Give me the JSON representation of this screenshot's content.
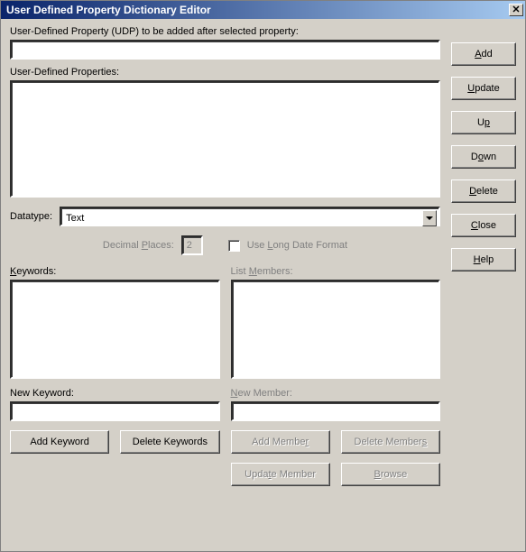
{
  "window": {
    "title": "User Defined Property Dictionary Editor"
  },
  "labels": {
    "udp_to_add": "User-Defined Property (UDP)  to be added after selected property:",
    "udp_list": "User-Defined Properties:",
    "datatype": "Datatype:",
    "decimal_places": "Decimal Places:",
    "use_long_date": "Use Long Date Format",
    "keywords": "Keywords:",
    "list_members": "List Members:",
    "new_keyword": "New Keyword:",
    "new_member": "New Member:"
  },
  "values": {
    "udp_input": "",
    "datatype_selected": "Text",
    "decimal_places": "2",
    "new_keyword": "",
    "new_member": ""
  },
  "buttons": {
    "add": "Add",
    "update": "Update",
    "up": "Up",
    "down": "Down",
    "delete": "Delete",
    "close": "Close",
    "help": "Help",
    "add_keyword": "Add Keyword",
    "delete_keywords": "Delete Keywords",
    "add_member": "Add Member",
    "delete_members": "Delete Members",
    "update_member": "Update Member",
    "browse": "Browse"
  }
}
